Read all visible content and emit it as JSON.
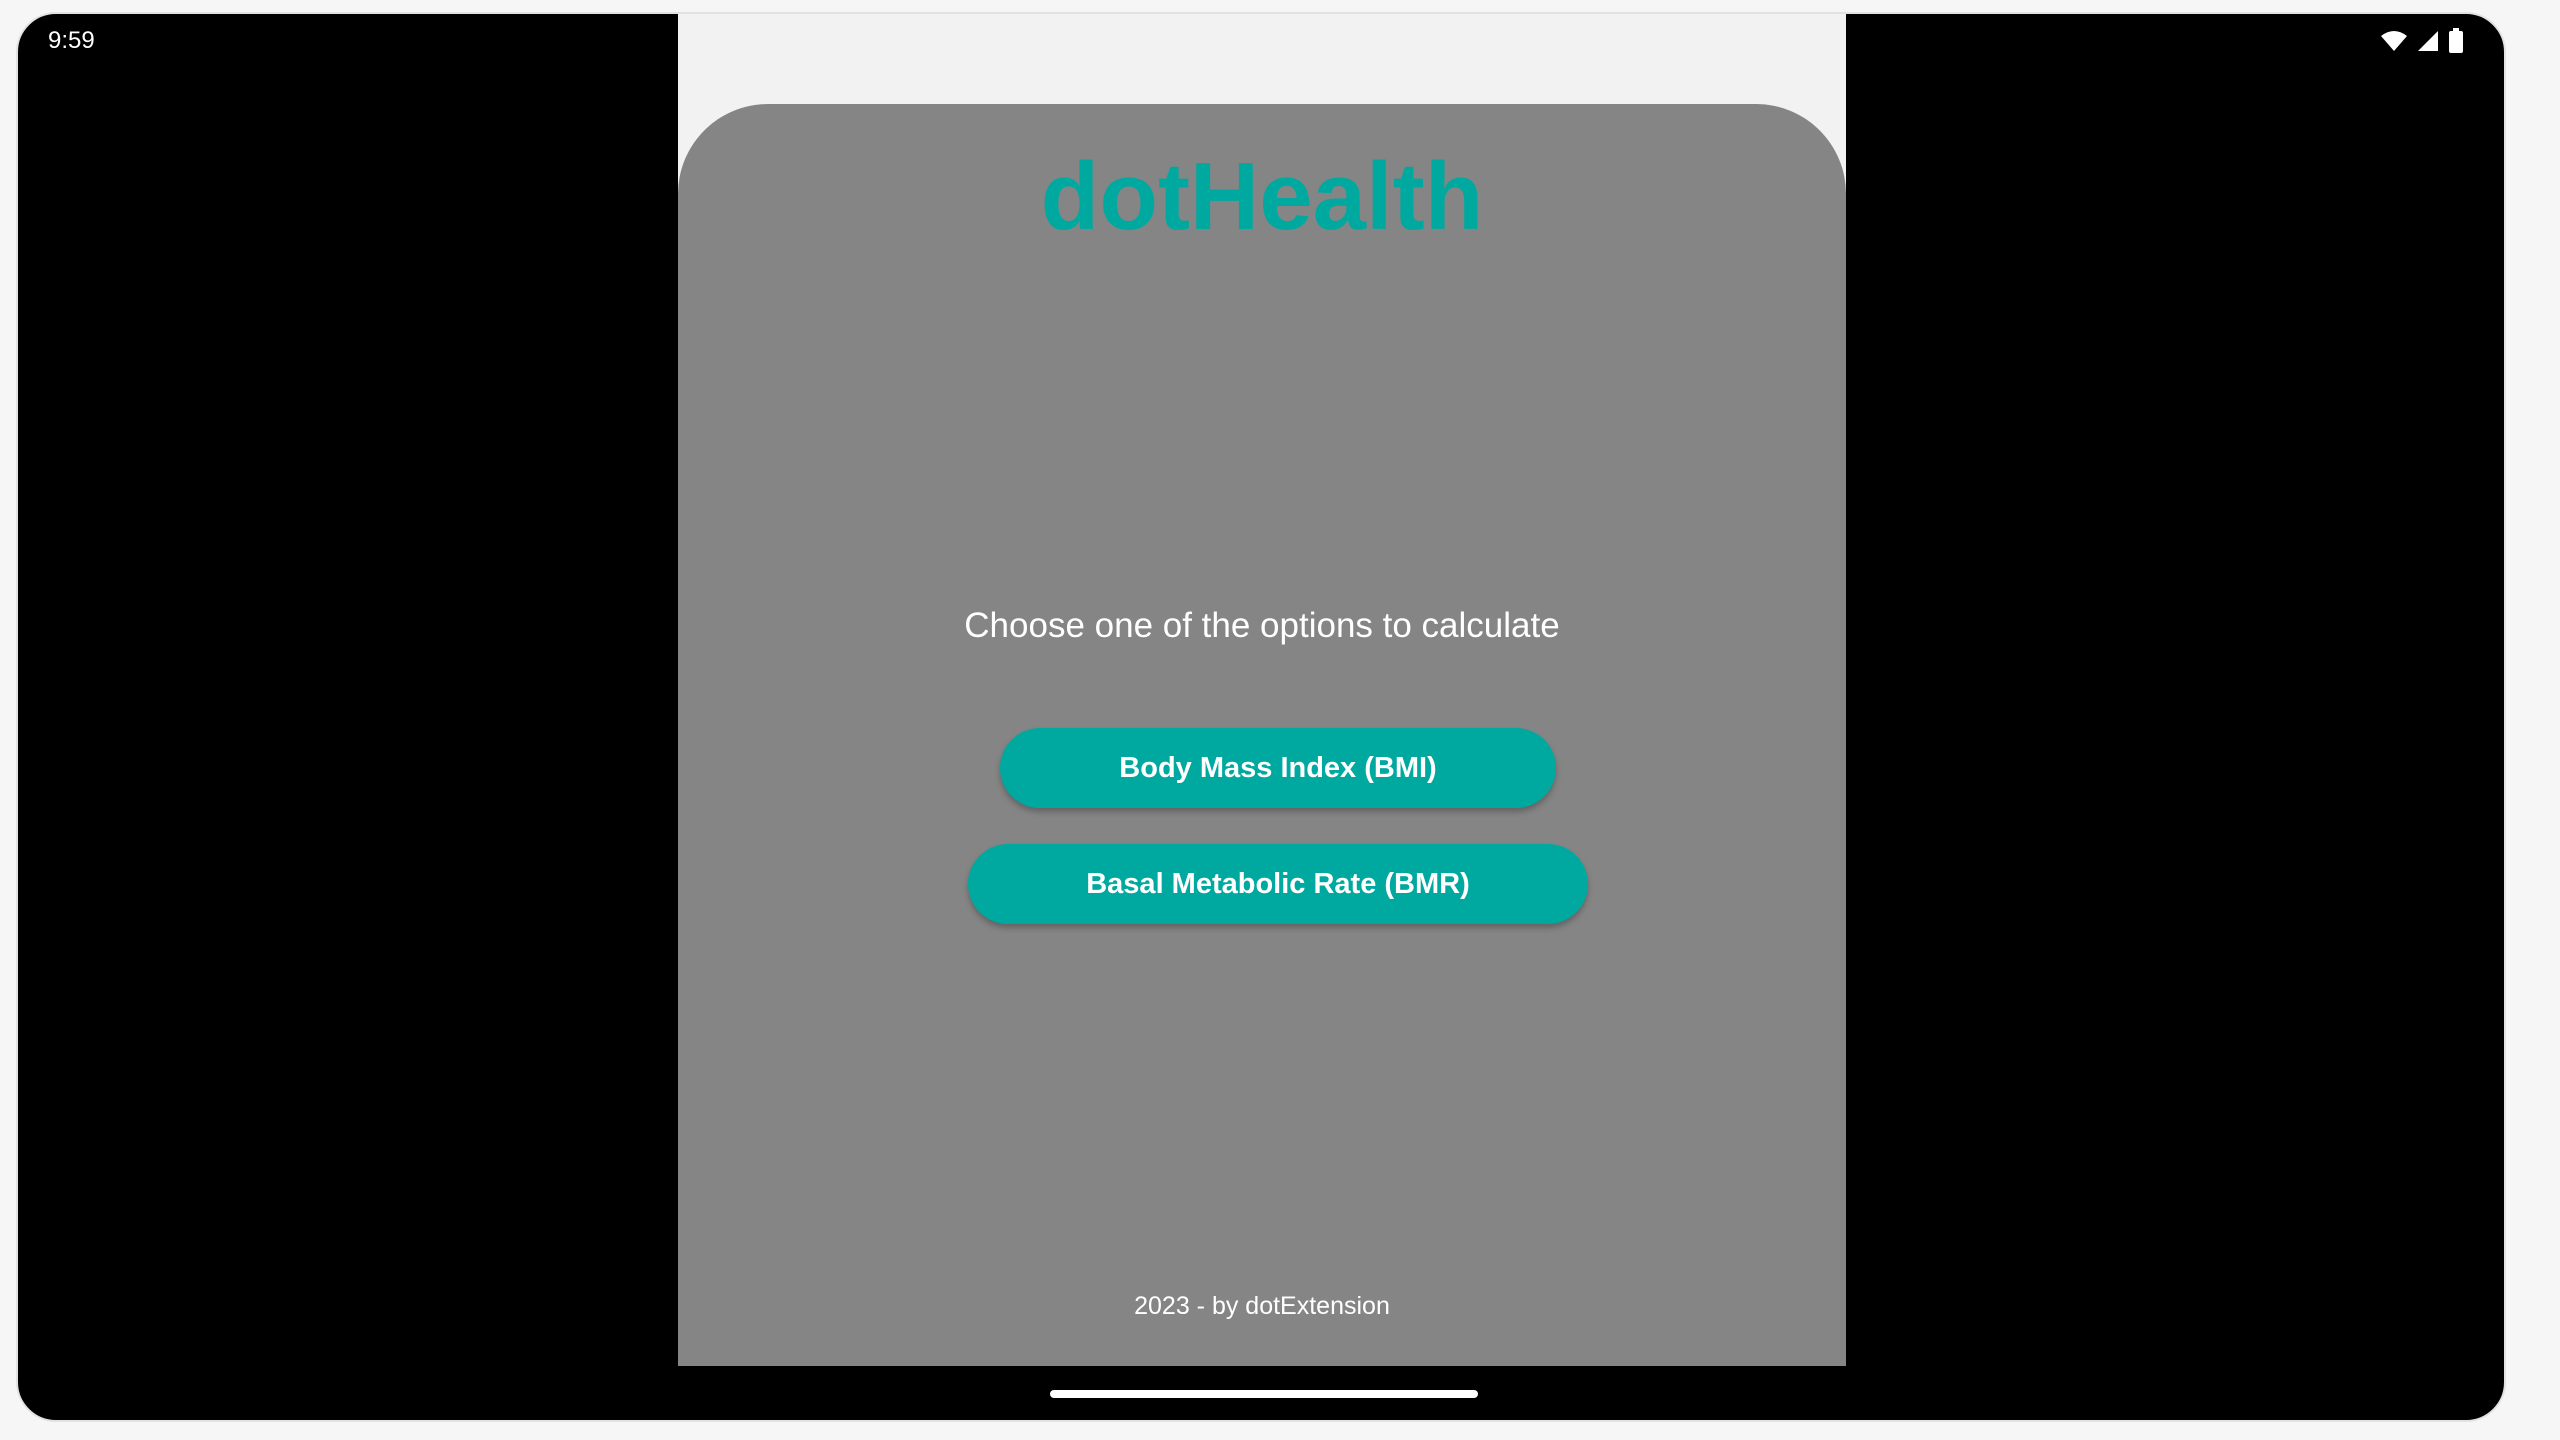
{
  "status_bar": {
    "time": "9:59",
    "icons": [
      "wifi-icon",
      "signal-icon",
      "battery-icon"
    ]
  },
  "app": {
    "title": "dotHealth",
    "prompt": "Choose one of the options to calculate",
    "options": [
      {
        "label": "Body Mass Index (BMI)"
      },
      {
        "label": "Basal Metabolic Rate (BMR)"
      }
    ],
    "footer": "2023 - by dotExtension"
  },
  "colors": {
    "accent": "#00A9A0",
    "card": "#858585",
    "background": "#f2f2f2"
  }
}
